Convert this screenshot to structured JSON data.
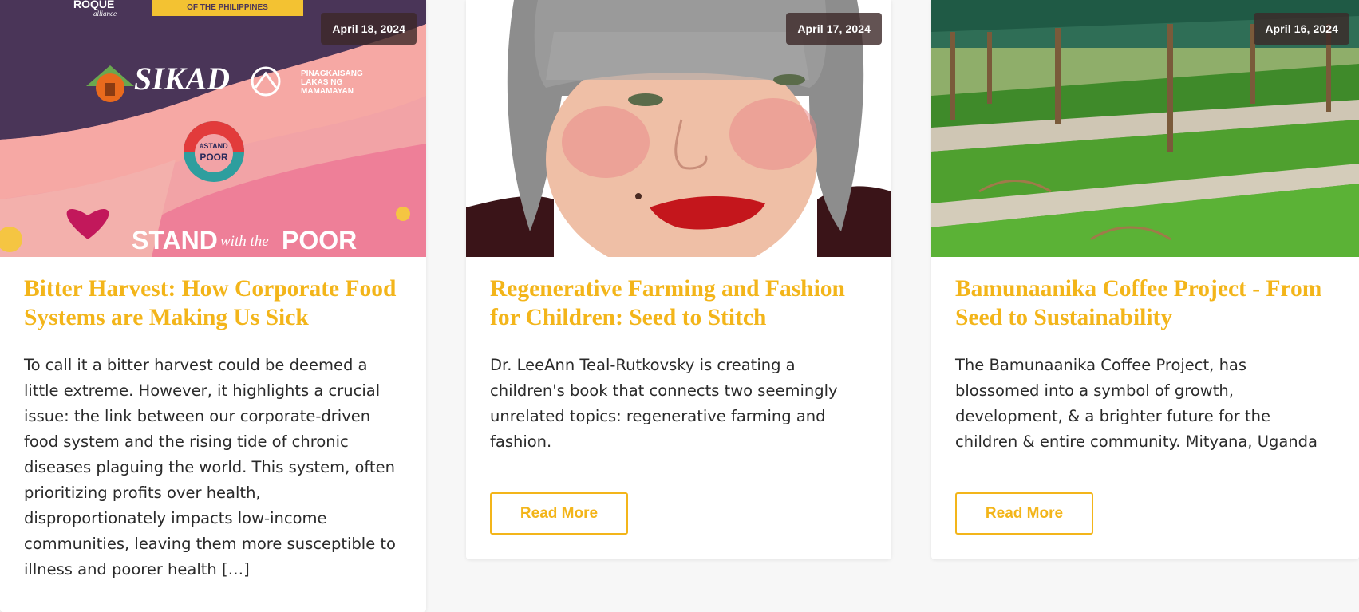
{
  "posts": [
    {
      "date": "April 18, 2024",
      "title": "Bitter Harvest: How Corporate Food Systems are Making Us Sick",
      "excerpt": "To call it a bitter harvest could be deemed a little extreme. However, it highlights a crucial issue: the link between our corporate-driven food system and the rising tide of chronic diseases plaguing the world. This system, often prioritizing profits over health, disproportionately impacts low-income communities, leaving them more susceptible to illness and poorer health […]",
      "image_text": {
        "roque": "ROQUE",
        "alliance": "alliance",
        "philippines": "OF THE PHILIPPINES",
        "sikad": "SIKAD",
        "pinag1": "PINAGKAISANG",
        "pinag2": "LAKAS NG",
        "pinag3": "MAMAMAYAN",
        "stand_badge1": "#STAND",
        "stand_badge2": "POOR",
        "stand_main": "STAND",
        "stand_with": "with the",
        "stand_poor": "POOR"
      }
    },
    {
      "date": "April 17, 2024",
      "title": "Regenerative Farming and Fashion for Children: Seed to Stitch",
      "excerpt": "Dr. LeeAnn Teal-Rutkovsky is creating a children's book that connects two seemingly unrelated topics: regenerative farming and fashion.",
      "read_more": "Read More"
    },
    {
      "date": "April 16, 2024",
      "title": "Bamunaanika Coffee Project - From Seed to Sustainability",
      "excerpt": "The Bamunaanika Coffee Project, has blossomed into a symbol of growth, development, & a brighter future for the children & entire community. Mityana, Uganda",
      "read_more": "Read More"
    }
  ],
  "colors": {
    "accent": "#f3b51a",
    "text": "#2a2a2a",
    "page_bg": "#f7f7f7",
    "badge_bg": "#3c2828"
  }
}
